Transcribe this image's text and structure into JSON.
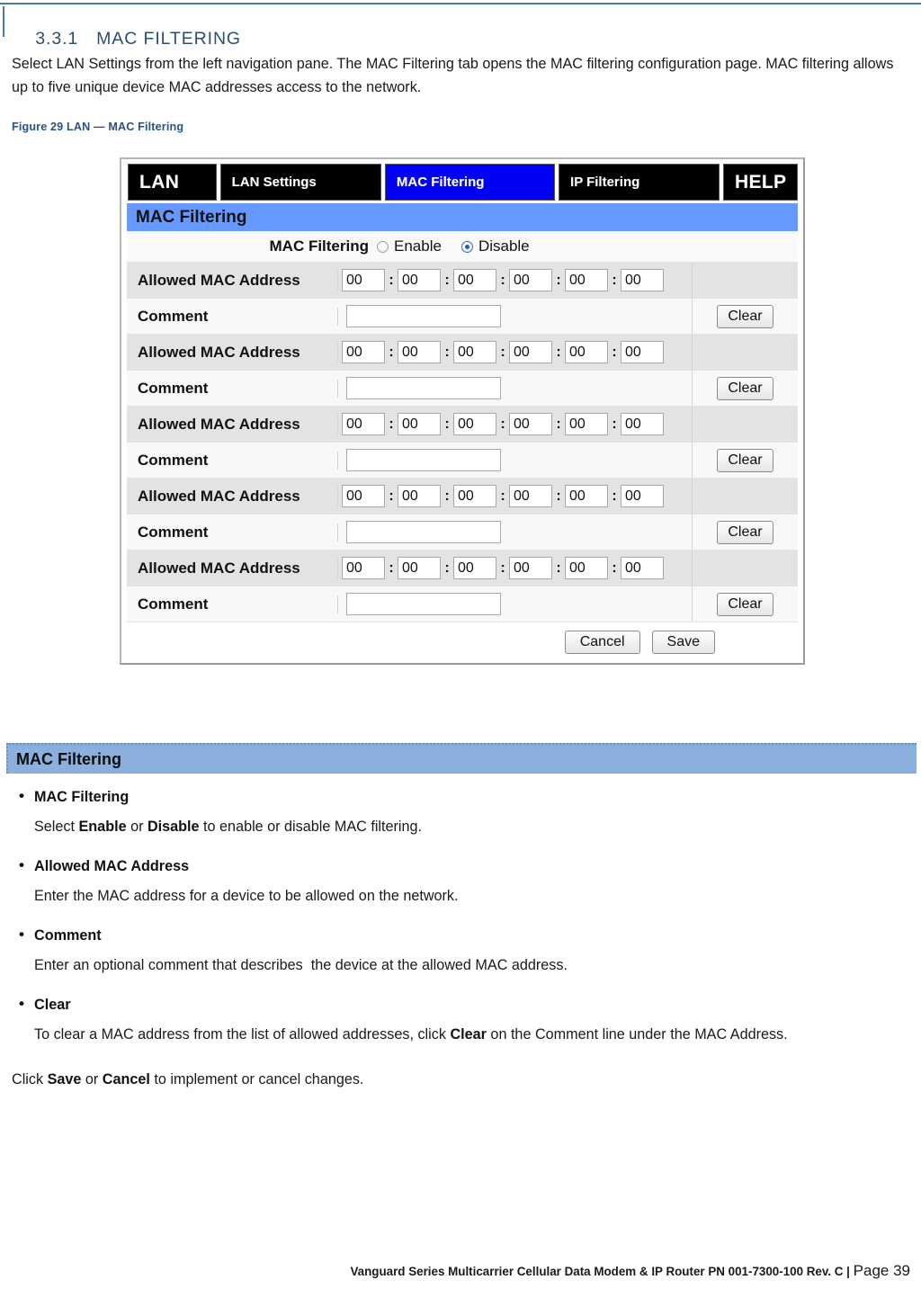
{
  "heading": {
    "number": "3.3.1",
    "title": "MAC FILTERING"
  },
  "intro_paragraph": "Select LAN Settings from the left navigation pane. The MAC Filtering tab opens the MAC filtering configuration page. MAC filtering allows up to five unique device MAC addresses access to the network.",
  "figure_caption": "Figure 29 LAN — MAC Filtering",
  "figure": {
    "tabs": [
      {
        "label": "LAN",
        "active": false
      },
      {
        "label": "LAN Settings",
        "active": false
      },
      {
        "label": "MAC Filtering",
        "active": true
      },
      {
        "label": "IP Filtering",
        "active": false
      },
      {
        "label": "HELP",
        "active": false
      }
    ],
    "section_title": "MAC Filtering",
    "toggle": {
      "label": "MAC Filtering",
      "options": [
        {
          "label": "Enable",
          "selected": false
        },
        {
          "label": "Disable",
          "selected": true
        }
      ]
    },
    "mac_label": "Allowed MAC Address",
    "comment_label": "Comment",
    "clear_label": "Clear",
    "octet_value": "00",
    "separator": ":",
    "comment_value": "",
    "entries": [
      {
        "octets": [
          "00",
          "00",
          "00",
          "00",
          "00",
          "00"
        ],
        "comment": ""
      },
      {
        "octets": [
          "00",
          "00",
          "00",
          "00",
          "00",
          "00"
        ],
        "comment": ""
      },
      {
        "octets": [
          "00",
          "00",
          "00",
          "00",
          "00",
          "00"
        ],
        "comment": ""
      },
      {
        "octets": [
          "00",
          "00",
          "00",
          "00",
          "00",
          "00"
        ],
        "comment": ""
      },
      {
        "octets": [
          "00",
          "00",
          "00",
          "00",
          "00",
          "00"
        ],
        "comment": ""
      }
    ],
    "cancel_label": "Cancel",
    "save_label": "Save"
  },
  "section": {
    "bar_title": "MAC Filtering",
    "items": [
      {
        "term": "MAC Filtering",
        "desc_pre": "Select ",
        "desc_b1": "Enable",
        "desc_mid": " or ",
        "desc_b2": "Disable",
        "desc_post": " to enable or disable MAC filtering."
      },
      {
        "term": "Allowed MAC Address",
        "desc_plain": "Enter the MAC address for a device to be allowed on the network."
      },
      {
        "term": "Comment",
        "desc_plain": "Enter an optional comment that describes  the device at the allowed MAC address."
      },
      {
        "term": "Clear",
        "desc_pre": "To clear a MAC address from the list of allowed addresses, click ",
        "desc_b1": "Clear",
        "desc_post": " on the Comment line under the MAC Address."
      }
    ],
    "closing": {
      "pre": "Click ",
      "b1": "Save",
      "mid": " or ",
      "b2": "Cancel",
      "post": " to implement or cancel changes."
    }
  },
  "footer": {
    "text": "Vanguard Series Multicarrier Cellular Data Modem & IP Router PN 001-7300-100 Rev. C",
    "divider": "|",
    "page": "Page 39"
  },
  "colors": {
    "heading_blue": "#2c4f74",
    "caption_blue": "#2c5282",
    "section_bar_blue": "#8cb0de",
    "ui_bar_blue": "#6699ff",
    "active_tab_blue": "#0000f5"
  }
}
